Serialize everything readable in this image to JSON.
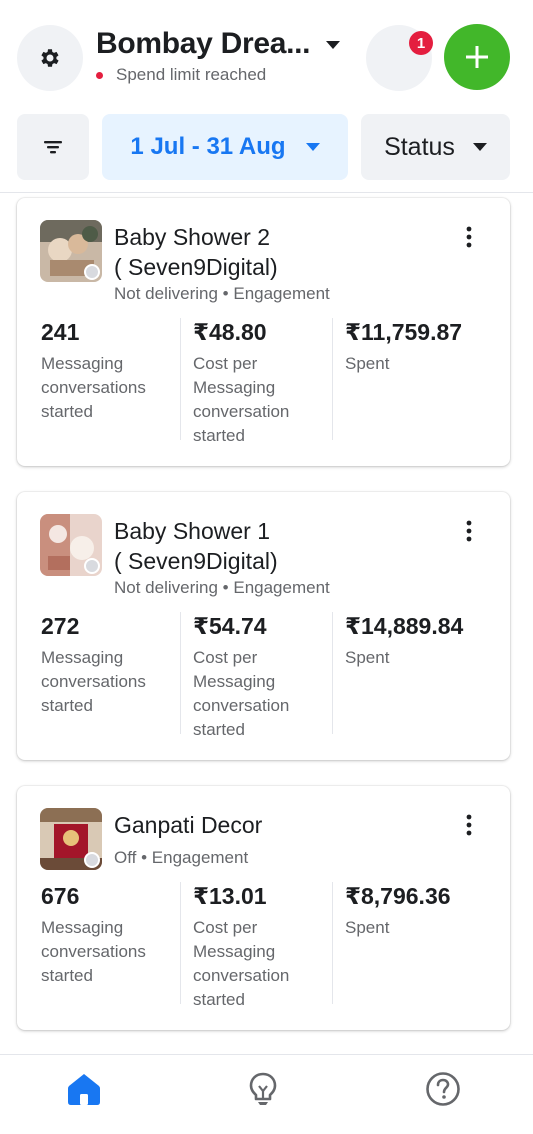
{
  "header": {
    "account_name": "Bombay Drea...",
    "status_text": "Spend limit reached",
    "notification_count": "1",
    "icons": {
      "settings": "gear-icon",
      "account_menu": "caret-down-icon",
      "create": "plus-icon"
    }
  },
  "filters": {
    "date_range": "1 Jul - 31 Aug",
    "status_label": "Status",
    "icons": {
      "filter": "filter-lines-icon"
    }
  },
  "campaigns": [
    {
      "name": "Baby Shower 2\n( Seven9Digital)",
      "delivery": "Not delivering",
      "objective": "Engagement",
      "metrics": [
        {
          "value": "241",
          "label": "Messaging conversations started"
        },
        {
          "value": "₹48.80",
          "label": "Cost per Messaging conversation started"
        },
        {
          "value": "₹11,759.87",
          "label": "Spent"
        }
      ]
    },
    {
      "name": "Baby Shower 1\n( Seven9Digital)",
      "delivery": "Not delivering",
      "objective": "Engagement",
      "metrics": [
        {
          "value": "272",
          "label": "Messaging conversations started"
        },
        {
          "value": "₹54.74",
          "label": "Cost per Messaging conversation started"
        },
        {
          "value": "₹14,889.84",
          "label": "Spent"
        }
      ]
    },
    {
      "name": "Ganpati Decor",
      "delivery": "Off",
      "objective": "Engagement",
      "metrics": [
        {
          "value": "676",
          "label": "Messaging conversations started"
        },
        {
          "value": "₹13.01",
          "label": "Cost per Messaging conversation started"
        },
        {
          "value": "₹8,796.36",
          "label": "Spent"
        }
      ]
    }
  ],
  "bottom_nav": {
    "items": [
      "home-icon",
      "lightbulb-icon",
      "help-icon"
    ],
    "active_index": 0
  },
  "colors": {
    "accent": "#1877f2",
    "accent_bg": "#e7f3ff",
    "create_button": "#42b72a",
    "alert": "#e41e3f",
    "secondary_text": "#65676b",
    "neutral_button": "#f0f2f5"
  }
}
